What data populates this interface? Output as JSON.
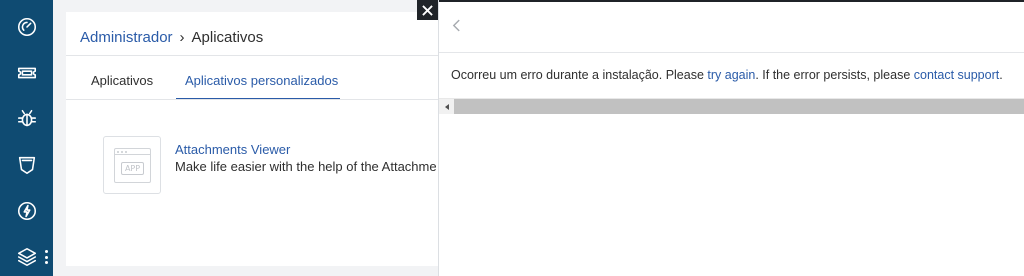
{
  "leftnav": {
    "icons": [
      "dashboard-gauge-icon",
      "ticket-icon",
      "bug-icon",
      "shield-icon",
      "lightning-icon",
      "layers-icon"
    ],
    "more": "more-options-icon"
  },
  "admin": {
    "breadcrumb": {
      "root": "Administrador",
      "separator": "›",
      "current": "Aplicativos"
    },
    "tabs": [
      {
        "label": "Aplicativos",
        "active": false
      },
      {
        "label": "Aplicativos personalizados",
        "active": true
      }
    ],
    "app": {
      "thumb_label": "APP",
      "title": "Attachments Viewer",
      "description": "Make life easier with the help of the Attachments"
    }
  },
  "panel": {
    "close_icon": "close-icon",
    "back_icon": "chevron-left-icon",
    "error": {
      "prefix": "Ocorreu um erro durante a instalação. Please ",
      "retry_link": "try again",
      "middle": ". If the error persists, please ",
      "support_link": "contact support",
      "suffix": "."
    }
  },
  "colors": {
    "nav_bg": "#0f4b72",
    "link": "#2a5ba8",
    "text": "#2f2f2f",
    "scroll_thumb": "#c1c1c1"
  }
}
